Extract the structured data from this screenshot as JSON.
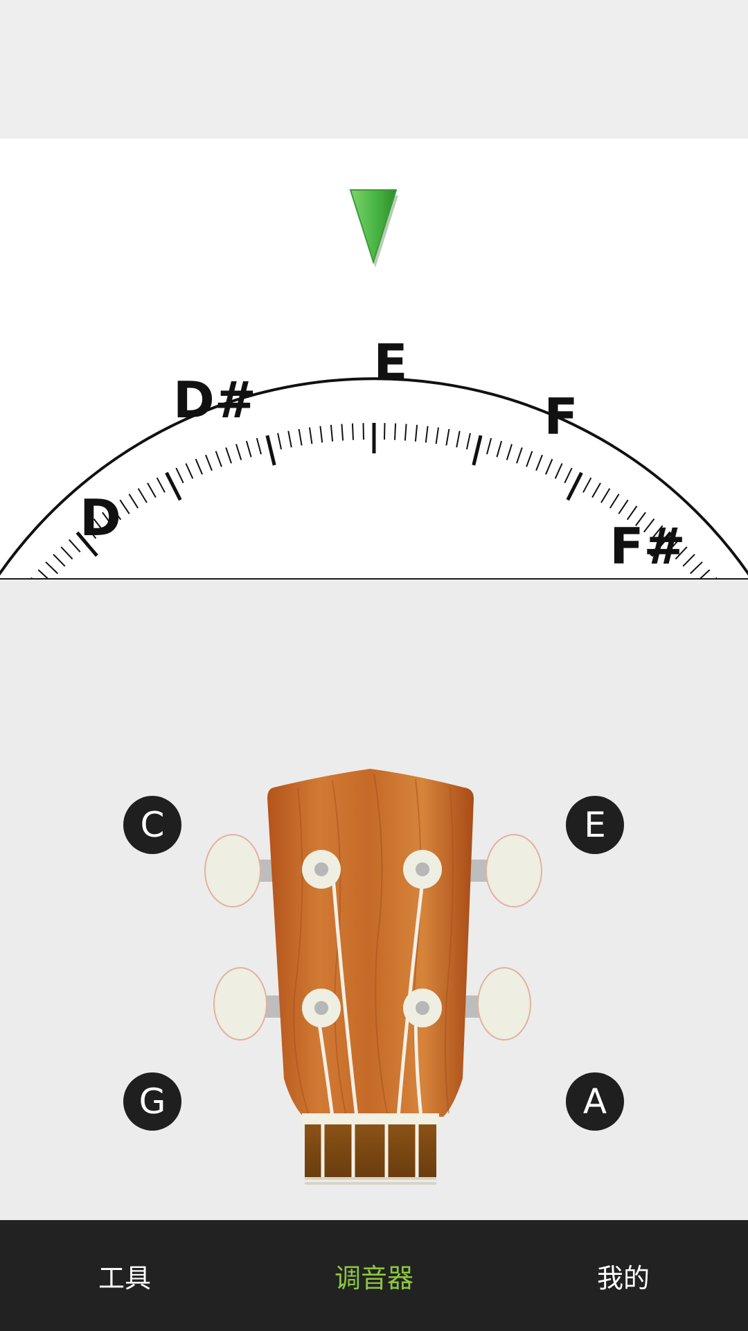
{
  "tuner": {
    "notes": [
      "D",
      "D#",
      "E",
      "F",
      "F#"
    ],
    "current_note": "E",
    "indicator_color": "#4cb848"
  },
  "strings": {
    "top_left": "C",
    "top_right": "E",
    "bottom_left": "G",
    "bottom_right": "A"
  },
  "nav": {
    "tools": "工具",
    "tuner": "调音器",
    "mine": "我的",
    "active": "tuner",
    "active_color": "#8cc63f"
  }
}
